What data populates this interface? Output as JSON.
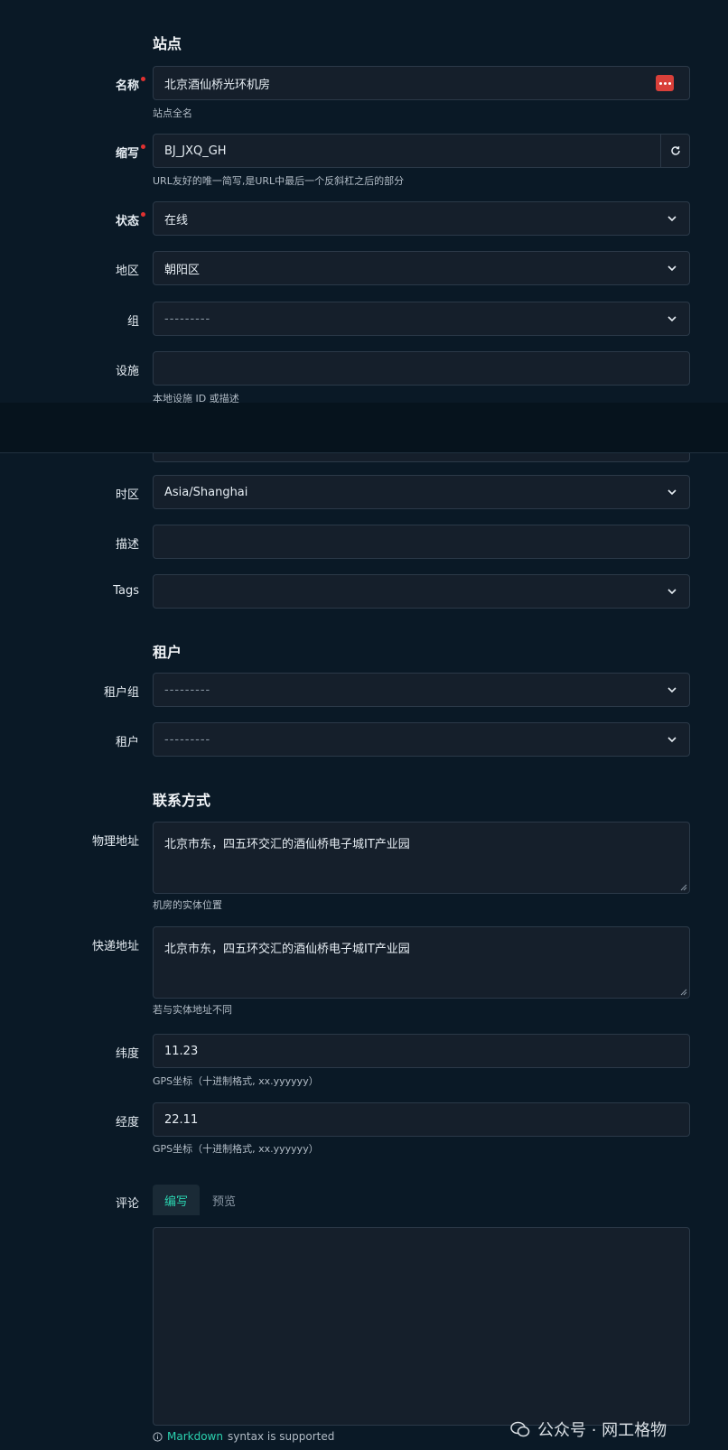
{
  "site_section": {
    "title": "站点",
    "name": {
      "label": "名称",
      "value": "北京酒仙桥光环机房",
      "hint": "站点全名"
    },
    "slug": {
      "label": "缩写",
      "value": "BJ_JXQ_GH",
      "hint": "URL友好的唯一简写,是URL中最后一个反斜杠之后的部分"
    },
    "status": {
      "label": "状态",
      "value": "在线"
    },
    "region": {
      "label": "地区",
      "value": "朝阳区"
    },
    "group": {
      "label": "组",
      "value": "---------"
    },
    "facility": {
      "label": "设施",
      "value": "",
      "hint": "本地设施 ID 或描述"
    }
  },
  "lower_fields": {
    "timezone": {
      "label": "时区",
      "value": "Asia/Shanghai"
    },
    "description": {
      "label": "描述",
      "value": ""
    },
    "tags": {
      "label": "Tags",
      "value": ""
    }
  },
  "tenant_section": {
    "title": "租户",
    "tenant_group": {
      "label": "租户组",
      "value": "---------"
    },
    "tenant": {
      "label": "租户",
      "value": "---------"
    }
  },
  "contact_section": {
    "title": "联系方式",
    "physical_address": {
      "label": "物理地址",
      "value": "北京市东，四五环交汇的酒仙桥电子城IT产业园",
      "hint": "机房的实体位置"
    },
    "shipping_address": {
      "label": "快递地址",
      "value": "北京市东，四五环交汇的酒仙桥电子城IT产业园",
      "hint": "若与实体地址不同"
    },
    "latitude": {
      "label": "纬度",
      "value": "11.23",
      "hint": "GPS坐标（十进制格式, xx.yyyyyy）"
    },
    "longitude": {
      "label": "经度",
      "value": "22.11",
      "hint": "GPS坐标（十进制格式, xx.yyyyyy）"
    }
  },
  "comments": {
    "label": "评论",
    "tab_write": "编写",
    "tab_preview": "预览",
    "value": "",
    "markdown_link": "Markdown",
    "markdown_suffix": "syntax is supported"
  },
  "watermark": {
    "text": "公众号 · 网工格物"
  },
  "colors": {
    "background": "#0a1926",
    "field_bg": "#151f2b",
    "accent": "#2bd3b0",
    "required": "#e03131"
  },
  "icons": {
    "name_field_button": "dots-icon",
    "slug_regenerate": "refresh-icon",
    "select_caret": "chevron-down-icon"
  }
}
